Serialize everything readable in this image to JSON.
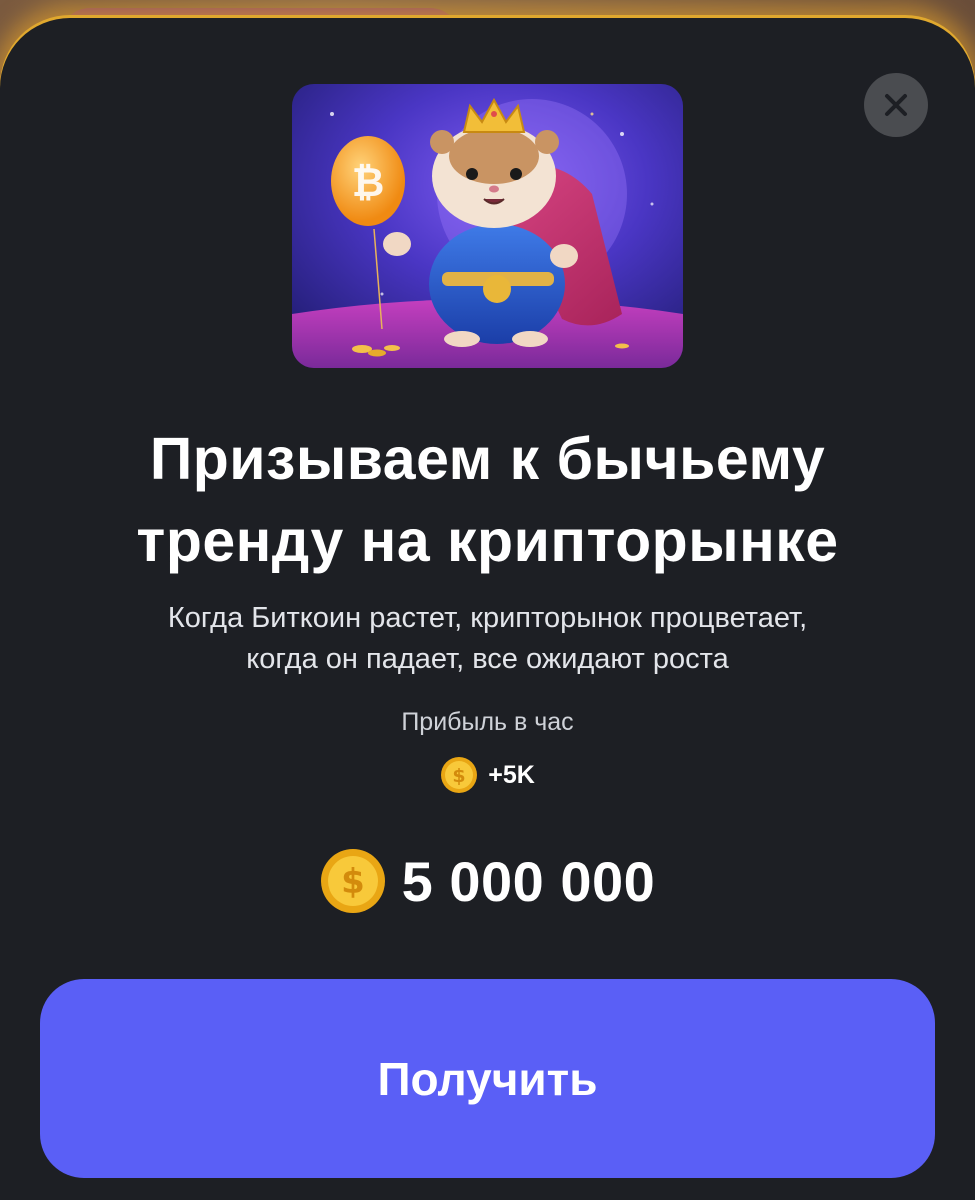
{
  "card": {
    "title_line1": "Призываем к бычьему",
    "title_line2": "тренду на крипторынке",
    "description_line1": "Когда Биткоин растет, крипторынок процветает,",
    "description_line2": "когда он падает, все ожидают роста",
    "profit_label": "Прибыль в час",
    "profit_value": "+5K",
    "price": "5 000 000",
    "cta_label": "Получить",
    "close_icon": "close-icon",
    "coin_icon": "coin-icon",
    "image": "hamster-king-bitcoin-balloon"
  },
  "colors": {
    "sheet_bg": "#1d1f24",
    "accent_button": "#5a5ff6",
    "glow_border": "#e0a82e",
    "coin": "#f4b81f"
  }
}
